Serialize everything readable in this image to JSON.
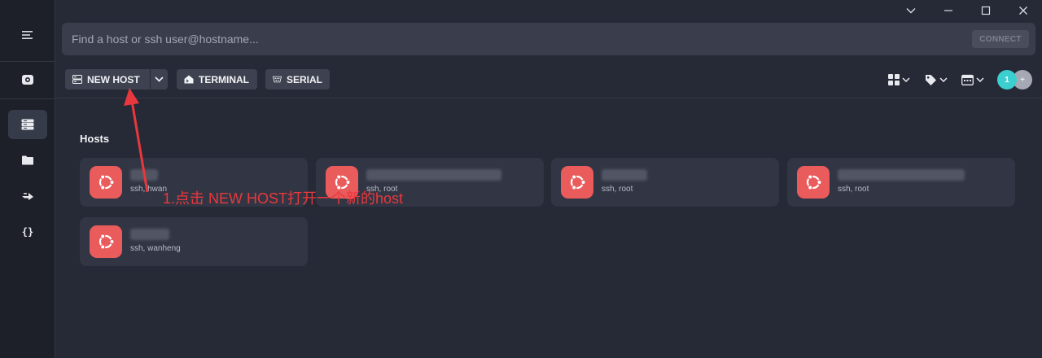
{
  "search": {
    "placeholder": "Find a host or ssh user@hostname...",
    "connect_label": "CONNECT"
  },
  "toolbar": {
    "new_host_label": "NEW HOST",
    "terminal_label": "TERMINAL",
    "serial_label": "SERIAL"
  },
  "avatars": {
    "count": "1",
    "add": "+"
  },
  "section": {
    "title": "Hosts"
  },
  "hosts": [
    {
      "name": "hwan",
      "sub": "ssh, hwan"
    },
    {
      "name": "host-2",
      "sub": "ssh, root"
    },
    {
      "name": "host-3",
      "sub": "ssh, root"
    },
    {
      "name": "host-4",
      "sub": "ssh, root"
    },
    {
      "name": "wanheng",
      "sub": "ssh, wanheng"
    }
  ],
  "annotation": {
    "text": "1.点击 NEW HOST打开一个新的host"
  },
  "colors": {
    "accent": "#ea5b5c",
    "avatar_teal": "#3ccfcf",
    "annotation": "#e8383d"
  }
}
